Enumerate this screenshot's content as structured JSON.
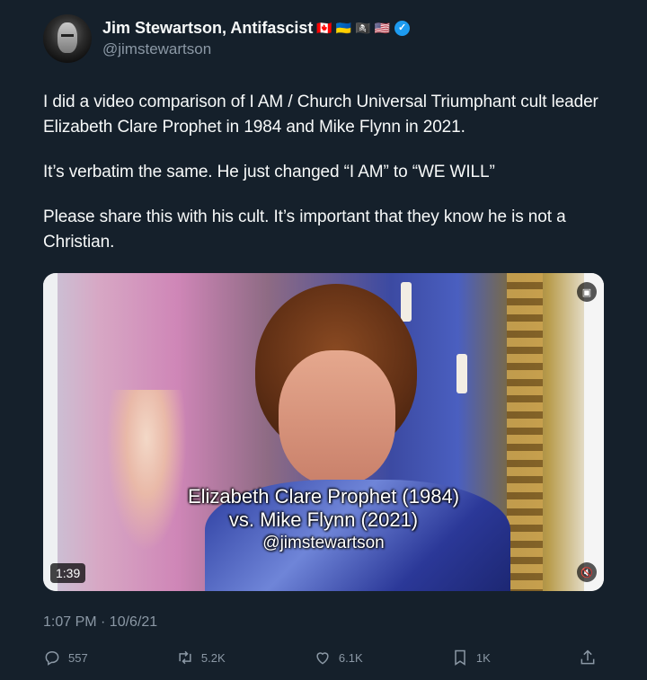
{
  "author": {
    "name": "Jim Stewartson, Antifascist",
    "handle": "@jimstewartson",
    "flags": [
      "🇨🇦",
      "🇺🇦",
      "🏴‍☠️",
      "🇺🇸"
    ]
  },
  "tweet": {
    "paragraphs": [
      "I did a video comparison of I AM / Church Universal Triumphant cult leader Elizabeth Clare Prophet in 1984 and Mike Flynn in 2021.",
      "It’s verbatim the same. He just changed “I AM” to “WE WILL”",
      "Please share this with his cult. It’s important that they know he is not a Christian."
    ],
    "timestamp": "1:07 PM · 10/6/21"
  },
  "video": {
    "caption_line1": "Elizabeth Clare Prophet (1984)",
    "caption_line2": "vs. Mike Flynn (2021)",
    "caption_line3": "@jimstewartson",
    "duration": "1:39"
  },
  "actions": {
    "replies": "557",
    "retweets": "5.2K",
    "likes": "6.1K",
    "bookmarks": "1K"
  },
  "colors": {
    "background": "#15202b",
    "text": "#f7f9f9",
    "muted": "#8b98a5",
    "verified": "#1d9bf0"
  }
}
